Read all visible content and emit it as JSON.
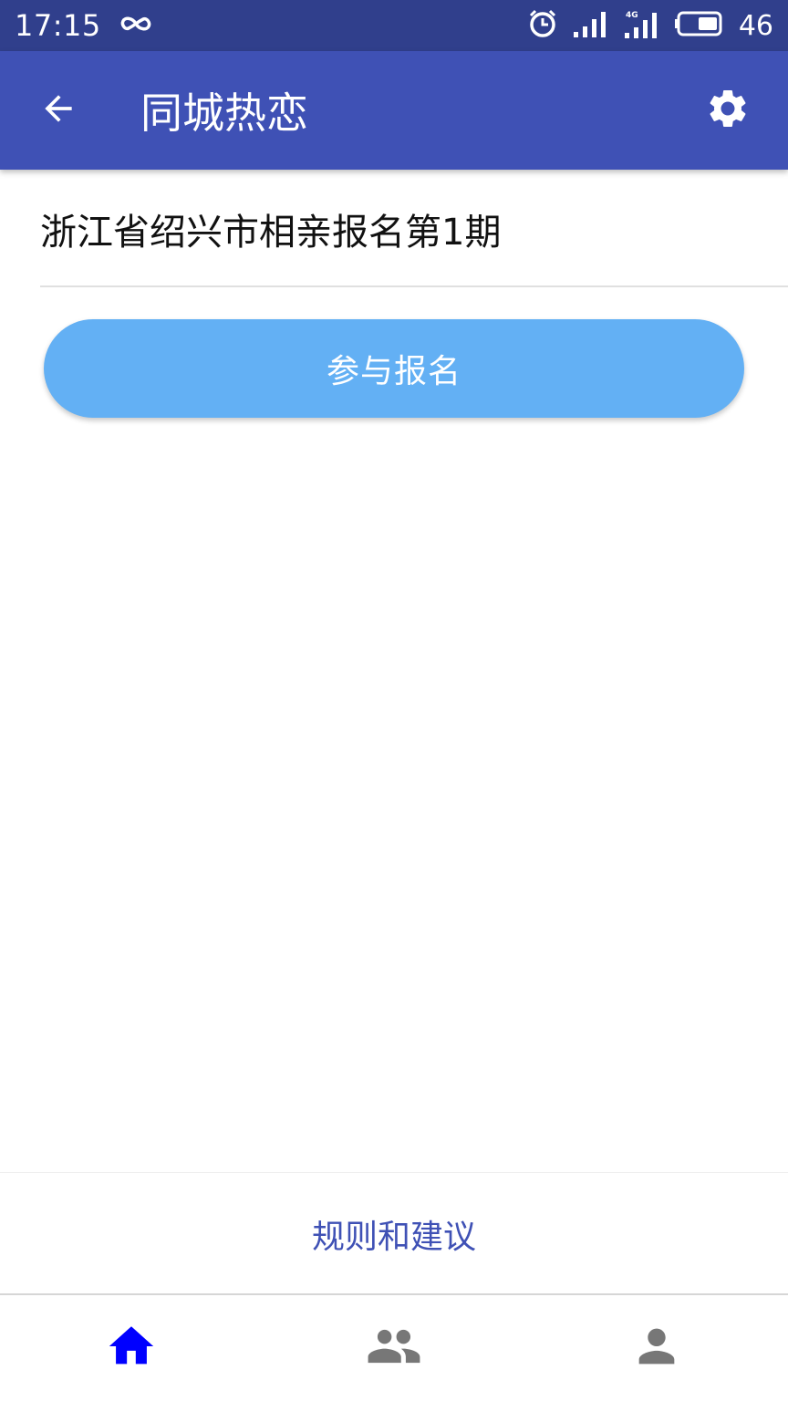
{
  "status_bar": {
    "time": "17:15",
    "battery_level": "46",
    "icons": [
      "infinity-icon",
      "alarm-icon",
      "signal-icon",
      "signal-4g-icon",
      "battery-icon"
    ]
  },
  "app_bar": {
    "title": "同城热恋",
    "back_icon": "arrow-back-icon",
    "settings_icon": "gear-icon"
  },
  "content": {
    "item_title": "浙江省绍兴市相亲报名第1期",
    "signup_button_label": "参与报名"
  },
  "footer": {
    "rules_link": "规则和建议"
  },
  "bottom_nav": {
    "items": [
      {
        "icon": "home-icon",
        "active": true
      },
      {
        "icon": "group-icon",
        "active": false
      },
      {
        "icon": "person-icon",
        "active": false
      }
    ]
  },
  "colors": {
    "status_bar": "#303f8c",
    "app_bar": "#3f51b5",
    "button": "#63b0f4",
    "link": "#3f51b5",
    "nav_active": "#0000ff",
    "nav_inactive": "#777777"
  }
}
